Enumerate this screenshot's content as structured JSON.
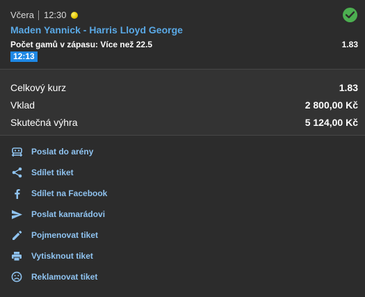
{
  "ticket": {
    "day": "Včera",
    "time": "12:30",
    "status": "won",
    "match": "Maden Yannick - Harris Lloyd George",
    "market_label": "Počet gamů v zápasu:",
    "selection": "Více než 22.5",
    "odd": "1.83",
    "event_time": "12:13"
  },
  "summary": {
    "total_odds_label": "Celkový kurz",
    "total_odds_value": "1.83",
    "stake_label": "Vklad",
    "stake_value": "2 800,00 Kč",
    "win_label": "Skutečná výhra",
    "win_value": "5 124,00 Kč"
  },
  "actions": [
    {
      "label": "Poslat do arény",
      "icon": "arena-icon"
    },
    {
      "label": "Sdílet tiket",
      "icon": "share-icon"
    },
    {
      "label": "Sdílet na Facebook",
      "icon": "facebook-icon"
    },
    {
      "label": "Poslat kamarádovi",
      "icon": "send-icon"
    },
    {
      "label": "Pojmenovat tiket",
      "icon": "pencil-icon"
    },
    {
      "label": "Vytisknout tiket",
      "icon": "print-icon"
    },
    {
      "label": "Reklamovat tiket",
      "icon": "sad-face-icon"
    }
  ],
  "colors": {
    "accent": "#5aa9e6",
    "badge": "#1e88e5",
    "success": "#4caf50",
    "background": "#2c2c2c"
  }
}
